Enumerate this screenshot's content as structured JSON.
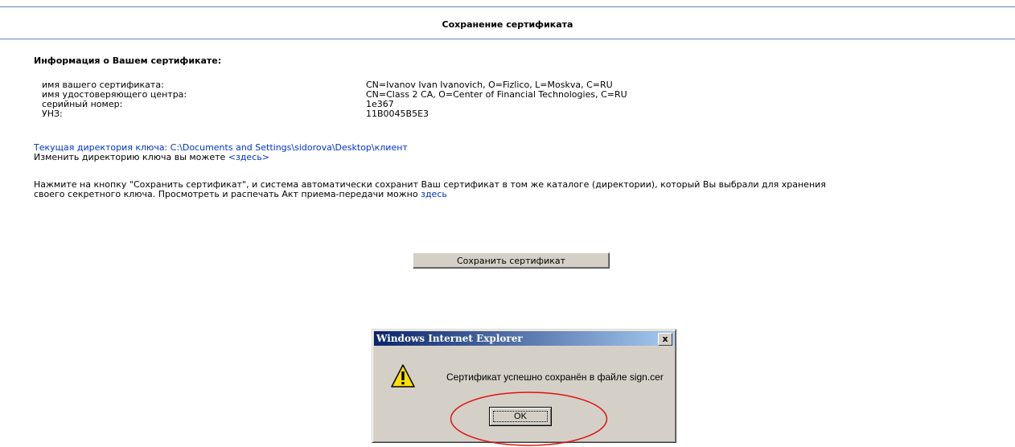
{
  "page": {
    "title": "Сохранение сертификата"
  },
  "info": {
    "heading": "Информация о Вашем сертификате:",
    "rows": [
      {
        "label": "имя вашего сертификата:",
        "value": "CN=Ivanov Ivan Ivanovich, O=Fizlico, L=Moskva, C=RU"
      },
      {
        "label": "имя удостоверяющего центра:",
        "value": "CN=Class 2 CA, O=Center of Financial Technologies, C=RU"
      },
      {
        "label": "серийный номер:",
        "value": "1e367"
      },
      {
        "label": "УНЗ:",
        "value": "11B0045B5E3"
      }
    ]
  },
  "key_dir": {
    "current_label": "Текущая директория ключа: C:\\Documents and Settings\\sidorova\\Desktop\\клиент",
    "change_prefix": "Изменить директорию ключа вы можете ",
    "change_link": "<здесь>"
  },
  "instructions": {
    "line1": "Нажмите на кнопку \"Сохранить сертификат\", и система автоматически сохранит Ваш сертификат в том же каталоге (директории), который Вы выбрали для хранения",
    "line2_prefix": "своего секретного ключа. Просмотреть и распечать Акт приема-передачи можно ",
    "line2_link": "здесь"
  },
  "save_button": "Сохранить сертификат",
  "dialog": {
    "title": "Windows Internet Explorer",
    "close": "x",
    "message": "Сертификат успешно сохранён в файле sign.cer",
    "ok": "OK",
    "icon": "warning-icon"
  },
  "colors": {
    "divider": "#5f84b0",
    "link": "#0033cc",
    "highlight": "#e01010"
  }
}
